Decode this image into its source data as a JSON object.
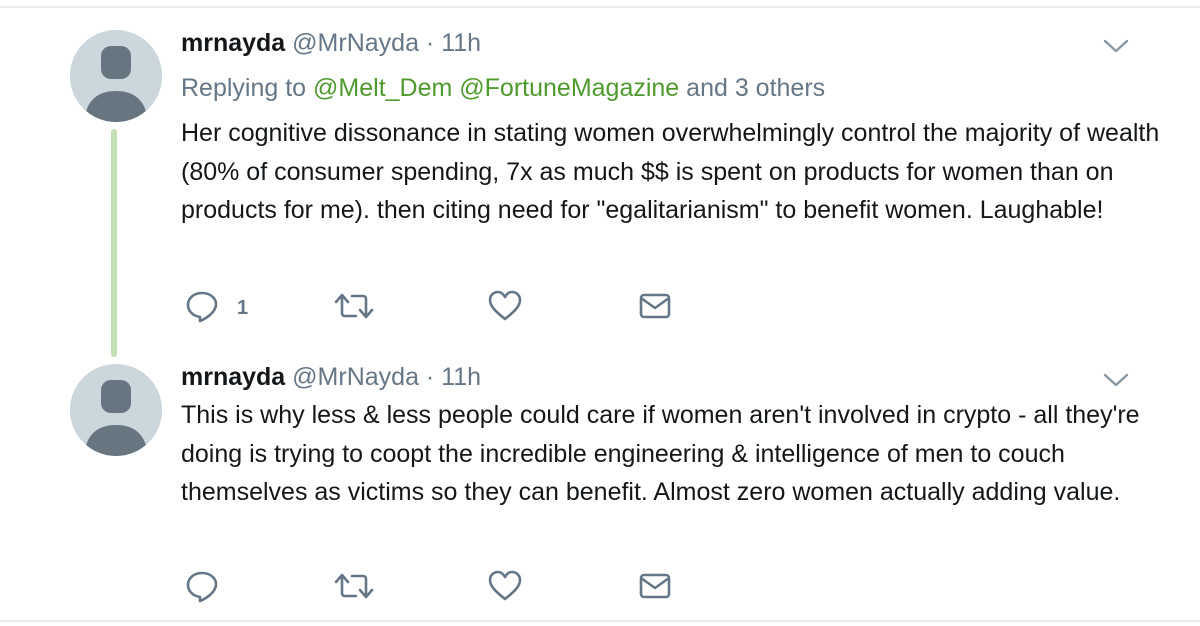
{
  "tweets": [
    {
      "name": "mrnayda",
      "handle": "@MrNayda",
      "separator": "·",
      "time": "11h",
      "replying_prefix": "Replying to",
      "replying_mentions": [
        "@Melt_Dem",
        "@FortuneMagazine"
      ],
      "replying_suffix": "and 3 others",
      "text": "Her cognitive dissonance in stating women overwhelmingly control the majority of wealth (80% of consumer spending, 7x as much $$ is spent on products for women than on products for me). then citing need for \"egalitarianism\" to benefit women. Laughable!",
      "reply_count": "1",
      "icons": {
        "avatar": "default-avatar-icon",
        "caret": "chevron-down-icon",
        "reply": "reply-icon",
        "retweet": "retweet-icon",
        "like": "heart-icon",
        "dm": "envelope-icon"
      }
    },
    {
      "name": "mrnayda",
      "handle": "@MrNayda",
      "separator": "·",
      "time": "11h",
      "text": "This is why less & less people could care if women aren't involved in crypto - all they're doing is trying to coopt the incredible engineering & intelligence of men to couch themselves as victims so they can benefit. Almost zero women actually adding value.",
      "reply_count": "",
      "icons": {
        "avatar": "default-avatar-icon",
        "caret": "chevron-down-icon",
        "reply": "reply-icon",
        "retweet": "retweet-icon",
        "like": "heart-icon",
        "dm": "envelope-icon"
      }
    }
  ],
  "colors": {
    "thread_line": "#c4dfb5",
    "mention": "#4e9a2e",
    "secondary_text": "#657786",
    "avatar_bg": "#ccd6dd",
    "avatar_fg": "#66757f"
  }
}
